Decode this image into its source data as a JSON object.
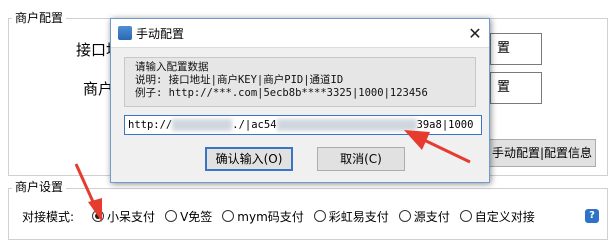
{
  "merchant_config": {
    "group_title": "商户配置",
    "api_label": "接口地",
    "merchant_label": "商户",
    "field1_value": "置",
    "field2_value": "置",
    "manual_config_button": "手动配置|配置信息"
  },
  "merchant_settings": {
    "group_title": "商户设置",
    "mode_label": "对接模式:",
    "options": [
      "小呆支付",
      "V免签",
      "mym码支付",
      "彩虹易支付",
      "源支付",
      "自定义对接"
    ],
    "selected_index": 0,
    "help_icon": "?"
  },
  "dialog": {
    "title": "手动配置",
    "close_glyph": "✕",
    "info_lines": [
      "请输入配置数据",
      "说明: 接口地址|商户KEY|商户PID|通道ID",
      "例子: http://***.com|5ecb8b****3325|1000|123456"
    ],
    "input_prefix": "http://",
    "input_mid": "./|ac54",
    "input_suffix": "39a8|1000",
    "confirm_button": "确认输入(O)",
    "cancel_button": "取消(C)"
  },
  "colors": {
    "arrow": "#e53c2f",
    "accent": "#3b73c5"
  }
}
